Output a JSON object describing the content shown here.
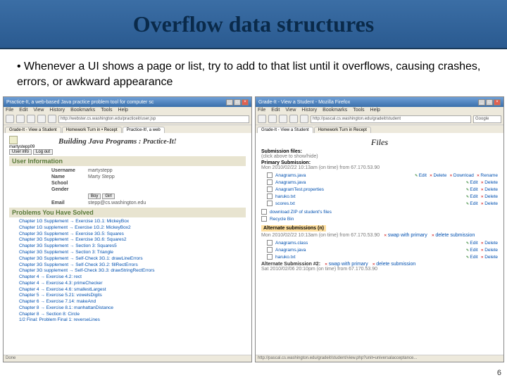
{
  "slide": {
    "title": "Overflow data structures",
    "bullet": "Whenever a UI shows a page or list, try to add to that list until it overflows, causing crashes, errors, or awkward appearance",
    "page_number": "6"
  },
  "left": {
    "window_title": "Practice-It, a web-based Java practice problem tool for computer sc",
    "menus": [
      "File",
      "Edit",
      "View",
      "History",
      "Bookmarks",
      "Tools",
      "Help"
    ],
    "address": "http://webster.cs.washington.edu/practiceit/user.jsp",
    "tabs": [
      "Grade-It - View a Student",
      "Homework Turn in • Recept",
      "Practice-It!, a web"
    ],
    "banner_main": "Building Java Programs",
    "banner_sub": ": Practice-It!",
    "user_box": {
      "name": "martystepp09",
      "buttons": [
        "User info",
        "Log out"
      ]
    },
    "section_user": "User Information",
    "fields": {
      "username": {
        "label": "Username",
        "value": "martystepp"
      },
      "name": {
        "label": "Name",
        "value": "Marty Stepp"
      },
      "school": {
        "label": "School",
        "value": ""
      },
      "gender": {
        "label": "Gender",
        "value": ""
      },
      "buttons": [
        "Boy",
        "Girl"
      ],
      "email": {
        "label": "Email",
        "value": "stepp@cs.washington.edu"
      }
    },
    "section_problems": "Problems You Have Solved",
    "problems": [
      "Chapter 1G Supplement → Exercise 1G.1: MickeyBox",
      "Chapter 1G supplement → Exercise 1G.2: MickeyBox2",
      "Chapter 3G Supplement → Exercise 3G.5: Squares",
      "Chapter 3G Supplement → Exercise 3G.6: Squares2",
      "Chapter 3G Supplement → Section 3: Squares5",
      "Chapter 3G Supplement → Section 3: Triangle",
      "Chapter 3G Supplement → Self-Check 3G.1: drawLineErrors",
      "Chapter 3G Supplement → Self-Check 3G.2: fillRectErrors",
      "Chapter 3G supplement → Self-Check 3G.3: drawStringRectErrors",
      "Chapter 4 → Exercise 4.2: rect",
      "Chapter 4 → Exercise 4.3: primeChecker",
      "Chapter 4 → Exercise 4.6: smallestLargest",
      "Chapter 5 → Exercise 5.21: vowelsDigits",
      "Chapter 6 → Exercise 7.14: makeAnd",
      "Chapter 8 → Exercise 8.1: manhattanDistance",
      "Chapter 8 → Section 8: Circle",
      "1/2 Final: Problem Final 1: reverseLines"
    ],
    "status": "Done"
  },
  "right": {
    "window_title": "Grade-It - View a Student - Mozilla Firefox",
    "menus": [
      "File",
      "Edit",
      "View",
      "History",
      "Bookmarks",
      "Tools",
      "Help"
    ],
    "address": "http://pascal.cs.washington.edu/gradeit/student",
    "search_label": "Google",
    "tabs": [
      "Grade-It - View a Student",
      "Homework Turn in Recept"
    ],
    "files_header": "Files",
    "sub_header": "Submission files:",
    "hint": "(click above to show/hide)",
    "primary_label": "Primary Submission:",
    "primary_time": "Mon 2010/02/22 10:13am (on time) from 67.170.53.90",
    "files1": [
      {
        "name": "Anagrams.java",
        "acts": [
          "Edit",
          "Delete",
          "Download",
          "Rename"
        ]
      },
      {
        "name": "Anagrams.java",
        "acts": [
          "Edit",
          "Delete"
        ]
      },
      {
        "name": "AnagramTest.properties",
        "acts": [
          "Edit",
          "Delete"
        ]
      },
      {
        "name": "haruko.txt",
        "acts": [
          "Edit",
          "Delete"
        ]
      },
      {
        "name": "scores.txt",
        "acts": [
          "Edit",
          "Delete"
        ]
      }
    ],
    "download_all": "download ZIP of student's files",
    "recycle": "Recycle Bin",
    "alt_header": "Alternate submissions (n)",
    "alt1_time": "Mon 2010/02/22 10:13am (on time) from 67.170.53.90",
    "alt1_actions": [
      "swap with primary",
      "delete submission"
    ],
    "files2": [
      {
        "name": "Anagrams.class",
        "acts": [
          "Edit",
          "Delete"
        ]
      },
      {
        "name": "Anagrams.java",
        "acts": [
          "Edit",
          "Delete"
        ]
      },
      {
        "name": "haruko.txt",
        "acts": [
          "Edit",
          "Delete"
        ]
      }
    ],
    "alt2_label": "Alternate Submission #2:",
    "alt2_actions": [
      "swap with primary",
      "delete submission"
    ],
    "alt2_time": "Sat 2010/02/06 20:10pm (on time) from 67.170.53.90",
    "status": "http://pascal.cs.washington.edu/gradeit/student/view.php?unit=universalacceptance..."
  }
}
